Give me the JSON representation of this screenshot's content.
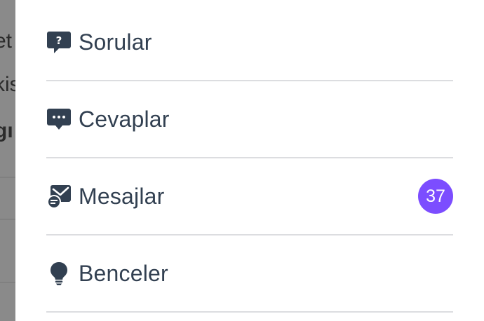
{
  "background": {
    "lines": [
      "et",
      "kis",
      "gı"
    ]
  },
  "menu": {
    "items": [
      {
        "label": "Sorular",
        "icon": "question-bubble-icon"
      },
      {
        "label": "Cevaplar",
        "icon": "comment-dots-icon"
      },
      {
        "label": "Mesajlar",
        "icon": "messages-icon",
        "badge": "37"
      },
      {
        "label": "Benceler",
        "icon": "lightbulb-icon"
      }
    ]
  },
  "colors": {
    "text": "#324051",
    "divider": "#dcdde0",
    "badge": "#7c4dff",
    "overlay": "#7a7a7a"
  }
}
